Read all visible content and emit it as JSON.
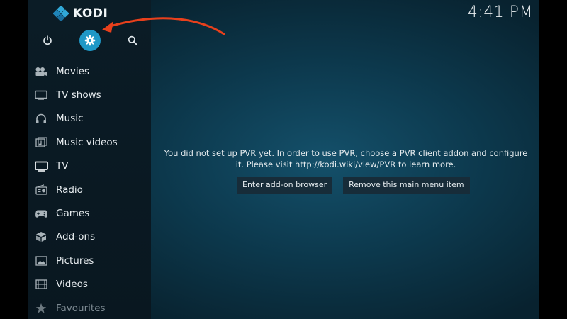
{
  "app": {
    "logo_text": "KODI",
    "clock": "4:41 PM"
  },
  "top_buttons": [
    {
      "name": "power-button",
      "icon": "power-icon"
    },
    {
      "name": "settings-button",
      "icon": "gear-icon"
    },
    {
      "name": "search-button",
      "icon": "search-icon"
    }
  ],
  "sidebar": {
    "items": [
      {
        "label": "Movies",
        "icon": "movies-icon"
      },
      {
        "label": "TV shows",
        "icon": "tv-shows-icon"
      },
      {
        "label": "Music",
        "icon": "headphones-icon"
      },
      {
        "label": "Music videos",
        "icon": "music-videos-icon"
      },
      {
        "label": "TV",
        "icon": "tv-icon"
      },
      {
        "label": "Radio",
        "icon": "radio-icon"
      },
      {
        "label": "Games",
        "icon": "gamepad-icon"
      },
      {
        "label": "Add-ons",
        "icon": "addons-icon"
      },
      {
        "label": "Pictures",
        "icon": "pictures-icon"
      },
      {
        "label": "Videos",
        "icon": "videos-icon"
      },
      {
        "label": "Favourites",
        "icon": "star-icon"
      }
    ]
  },
  "main": {
    "message_line1": "You did not set up PVR yet. In order to use PVR, choose a PVR client addon and configure",
    "message_line2": "it. Please visit http://kodi.wiki/view/PVR to learn more.",
    "buttons": {
      "enter_addon_browser": "Enter add-on browser",
      "remove_menu_item": "Remove this main menu item"
    }
  },
  "colors": {
    "accent": "#1f98c7",
    "annotation_arrow": "#e8401c",
    "background": "#0d3b50",
    "sidebar": "#0b1c26"
  }
}
